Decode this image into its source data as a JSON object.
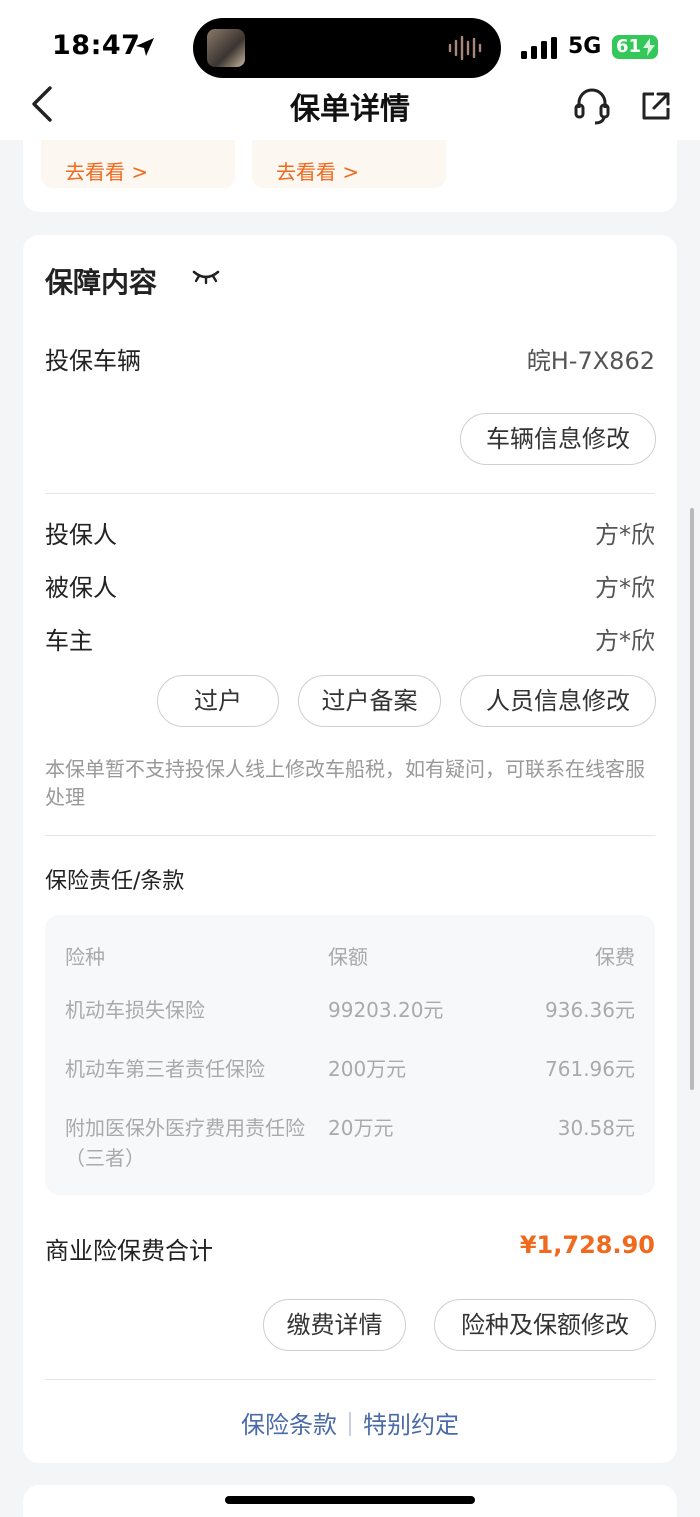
{
  "status_bar": {
    "time": "18:47",
    "network": "5G",
    "battery": "61"
  },
  "nav": {
    "title": "保单详情"
  },
  "top_card": {
    "link_1": "去看看 >",
    "link_2": "去看看 >"
  },
  "coverage": {
    "title": "保障内容",
    "vehicle_label": "投保车辆",
    "vehicle_value": "皖H-7X862",
    "vehicle_edit_button": "车辆信息修改",
    "applicant_label": "投保人",
    "applicant_value": "方*欣",
    "insured_label": "被保人",
    "insured_value": "方*欣",
    "owner_label": "车主",
    "owner_value": "方*欣",
    "transfer_button": "过户",
    "transfer_record_button": "过户备案",
    "person_edit_button": "人员信息修改",
    "note": "本保单暂不支持投保人线上修改车船税，如有疑问，可联系在线客服处理",
    "terms_title": "保险责任/条款",
    "table": {
      "headers": [
        "险种",
        "保额",
        "保费"
      ],
      "rows": [
        {
          "type": "机动车损失保险",
          "amount": "99203.20元",
          "premium": "936.36元"
        },
        {
          "type": "机动车第三者责任保险",
          "amount": "200万元",
          "premium": "761.96元"
        },
        {
          "type": "附加医保外医疗费用责任险（三者）",
          "amount": "20万元",
          "premium": "30.58元"
        }
      ]
    },
    "total_label": "商业险保费合计",
    "total_value": "¥1,728.90",
    "payment_button": "缴费详情",
    "coverage_edit_button": "险种及保额修改",
    "terms_link": "保险条款",
    "special_link": "特别约定"
  },
  "colors": {
    "accent": "#f06a1e",
    "link": "#4a6aa8",
    "battery": "#34c759"
  }
}
